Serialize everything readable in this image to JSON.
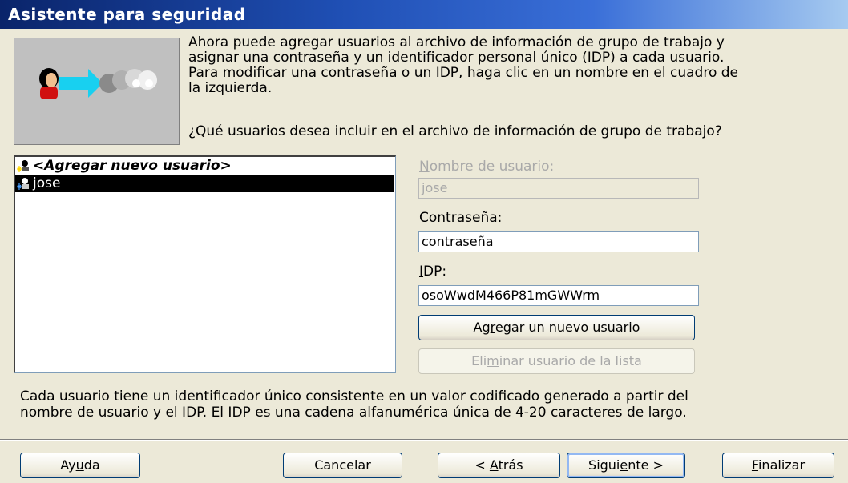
{
  "window": {
    "title": "Asistente para seguridad"
  },
  "intro": {
    "text": "Ahora puede agregar usuarios al archivo de información de grupo de trabajo y\nasignar una contraseña y un identificador personal único (IDP) a cada usuario.\nPara modificar una contraseña o un IDP, haga clic en un nombre en el cuadro de\nla izquierda.",
    "question": "¿Qué usuarios desea incluir en el archivo de información de grupo de trabajo?"
  },
  "user_list": {
    "items": [
      {
        "label": "<Agregar nuevo usuario>",
        "selected": false
      },
      {
        "label": "jose",
        "selected": true
      }
    ]
  },
  "form": {
    "username_label": {
      "accel": "N",
      "rest": "ombre de usuario:"
    },
    "username_value": "jose",
    "password_label": {
      "accel": "C",
      "rest": "ontraseña:"
    },
    "password_value": "contraseña",
    "pid_label": {
      "accel": "I",
      "rest": "DP:"
    },
    "pid_value": "osoWwdM466P81mGWWrm",
    "add_button": {
      "pre": "Ag",
      "accel": "r",
      "post": "egar un nuevo usuario"
    },
    "remove_button": {
      "pre": "Eli",
      "accel": "m",
      "post": "inar usuario de la lista"
    }
  },
  "note": "Cada usuario tiene un identificador único consistente en un valor codificado generado a partir del\nnombre de usuario y el IDP. El IDP es una cadena alfanumérica única de 4-20 caracteres de largo.",
  "buttons": {
    "help": {
      "pre": "Ay",
      "accel": "u",
      "post": "da"
    },
    "cancel": {
      "pre": "Cancelar",
      "accel": "",
      "post": ""
    },
    "back": {
      "pre": "< ",
      "accel": "A",
      "post": "trás"
    },
    "next": {
      "pre": "Sigui",
      "accel": "e",
      "post": "nte >"
    },
    "finish": {
      "pre": "",
      "accel": "F",
      "post": "inalizar"
    }
  },
  "colors": {
    "title_bar": "#0a246a",
    "selection": "#000000",
    "dialog_bg": "#ece9d8"
  }
}
